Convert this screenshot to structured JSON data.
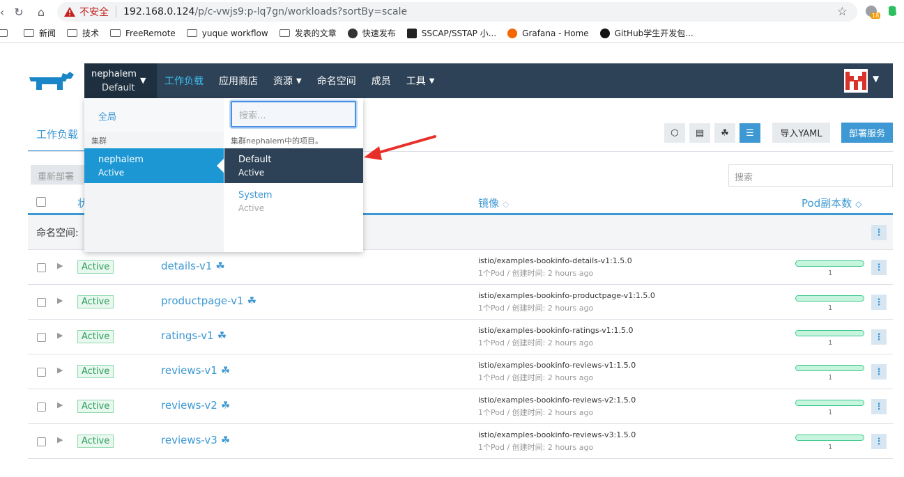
{
  "browser": {
    "insecure_label": "不安全",
    "url_host": "192.168.0.124",
    "url_path": "/p/c-vwjs9:p-lq7gn/workloads?sortBy=scale",
    "ext_badge": "18",
    "bookmarks": [
      "新闻",
      "技术",
      "FreeRemote",
      "yuque workflow",
      "发表的文章",
      "快速发布",
      "SSCAP/SSTAP 小...",
      "Grafana - Home",
      "GitHub学生开发包..."
    ]
  },
  "header": {
    "cluster_name": "nephalem",
    "project_name": "Default",
    "nav": [
      {
        "label": "工作负载"
      },
      {
        "label": "应用商店"
      },
      {
        "label": "资源"
      },
      {
        "label": "命名空间"
      },
      {
        "label": "成员"
      },
      {
        "label": "工具"
      }
    ]
  },
  "dropdown": {
    "global_label": "全局",
    "cluster_section": "集群",
    "cluster": {
      "name": "nephalem",
      "state": "Active"
    },
    "search_placeholder": "搜索...",
    "project_section": "集群nephalem中的项目。",
    "projects": [
      {
        "name": "Default",
        "state": "Active"
      },
      {
        "name": "System",
        "state": "Active"
      }
    ]
  },
  "page": {
    "tab": "工作负载",
    "import_yaml": "导入YAML",
    "deploy": "部署服务",
    "redeploy": "重新部署",
    "search_placeholder": "搜索",
    "columns": {
      "state": "状",
      "image": "镜像",
      "scale": "Pod副本数"
    },
    "namespace_label": "命名空间:"
  },
  "workloads": [
    {
      "state": "Active",
      "name": "details-v1",
      "image": "istio/examples-bookinfo-details-v1:1.5.0",
      "meta": "1个Pod / 创建时间: 2 hours ago",
      "pods": "1"
    },
    {
      "state": "Active",
      "name": "productpage-v1",
      "image": "istio/examples-bookinfo-productpage-v1:1.5.0",
      "meta": "1个Pod / 创建时间: 2 hours ago",
      "pods": "1"
    },
    {
      "state": "Active",
      "name": "ratings-v1",
      "image": "istio/examples-bookinfo-ratings-v1:1.5.0",
      "meta": "1个Pod / 创建时间: 2 hours ago",
      "pods": "1"
    },
    {
      "state": "Active",
      "name": "reviews-v1",
      "image": "istio/examples-bookinfo-reviews-v1:1.5.0",
      "meta": "1个Pod / 创建时间: 2 hours ago",
      "pods": "1"
    },
    {
      "state": "Active",
      "name": "reviews-v2",
      "image": "istio/examples-bookinfo-reviews-v2:1.5.0",
      "meta": "1个Pod / 创建时间: 2 hours ago",
      "pods": "1"
    },
    {
      "state": "Active",
      "name": "reviews-v3",
      "image": "istio/examples-bookinfo-reviews-v3:1.5.0",
      "meta": "1个Pod / 创建时间: 2 hours ago",
      "pods": "1"
    }
  ],
  "colors": {
    "accent": "#3d98d3",
    "header": "#2d4257",
    "active_green": "#2a9d5c"
  }
}
